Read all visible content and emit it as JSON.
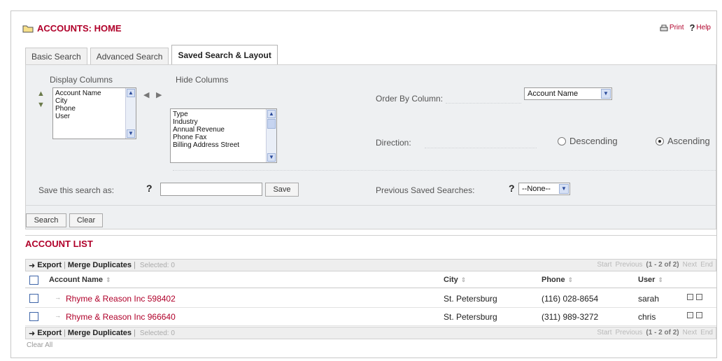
{
  "header": {
    "title": "ACCOUNTS: HOME",
    "print_label": "Print",
    "help_label": "Help"
  },
  "tabs": [
    {
      "label": "Basic Search",
      "active": false
    },
    {
      "label": "Advanced Search",
      "active": false
    },
    {
      "label": "Saved Search & Layout",
      "active": true
    }
  ],
  "layout_panel": {
    "display_columns_label": "Display Columns",
    "hide_columns_label": "Hide Columns",
    "display_columns": [
      "Account Name",
      "City",
      "Phone",
      "User"
    ],
    "hide_columns": [
      "Type",
      "Industry",
      "Annual Revenue",
      "Phone Fax",
      "Billing Address Street"
    ],
    "order_by_label": "Order By Column:",
    "order_by_value": "Account Name",
    "direction_label": "Direction:",
    "direction_descending": "Descending",
    "direction_ascending": "Ascending",
    "direction_selected": "Ascending",
    "save_search_label": "Save this search as:",
    "save_search_value": "",
    "save_button": "Save",
    "previous_searches_label": "Previous Saved Searches:",
    "previous_searches_value": "--None--",
    "help_glyph": "?"
  },
  "actions": {
    "search_button": "Search",
    "clear_button": "Clear"
  },
  "list": {
    "title": "ACCOUNT LIST",
    "toolbar": {
      "export": "Export",
      "merge": "Merge Duplicates",
      "selected": "Selected: 0",
      "start": "Start",
      "previous": "Previous",
      "count": "(1 - 2 of 2)",
      "next": "Next",
      "end": "End"
    },
    "columns": [
      "Account Name",
      "City",
      "Phone",
      "User"
    ],
    "rows": [
      {
        "name": "Rhyme & Reason Inc 598402",
        "city": "St. Petersburg",
        "phone": "(116) 028-8654",
        "user": "sarah"
      },
      {
        "name": "Rhyme & Reason Inc 966640",
        "city": "St. Petersburg",
        "phone": "(311) 989-3272",
        "user": "chris"
      }
    ],
    "footer_text": "Clear All"
  },
  "colors": {
    "accent": "#b0002a",
    "panel_bg": "#eef0f2",
    "checkbox_border": "#3d64a8"
  },
  "icons": [
    "folder-icon",
    "print-icon",
    "help-icon",
    "move-up-icon",
    "move-down-icon",
    "move-left-icon",
    "move-right-icon",
    "export-arrow-icon",
    "sort-icon",
    "edit-icon",
    "view-icon",
    "expand-icon"
  ]
}
